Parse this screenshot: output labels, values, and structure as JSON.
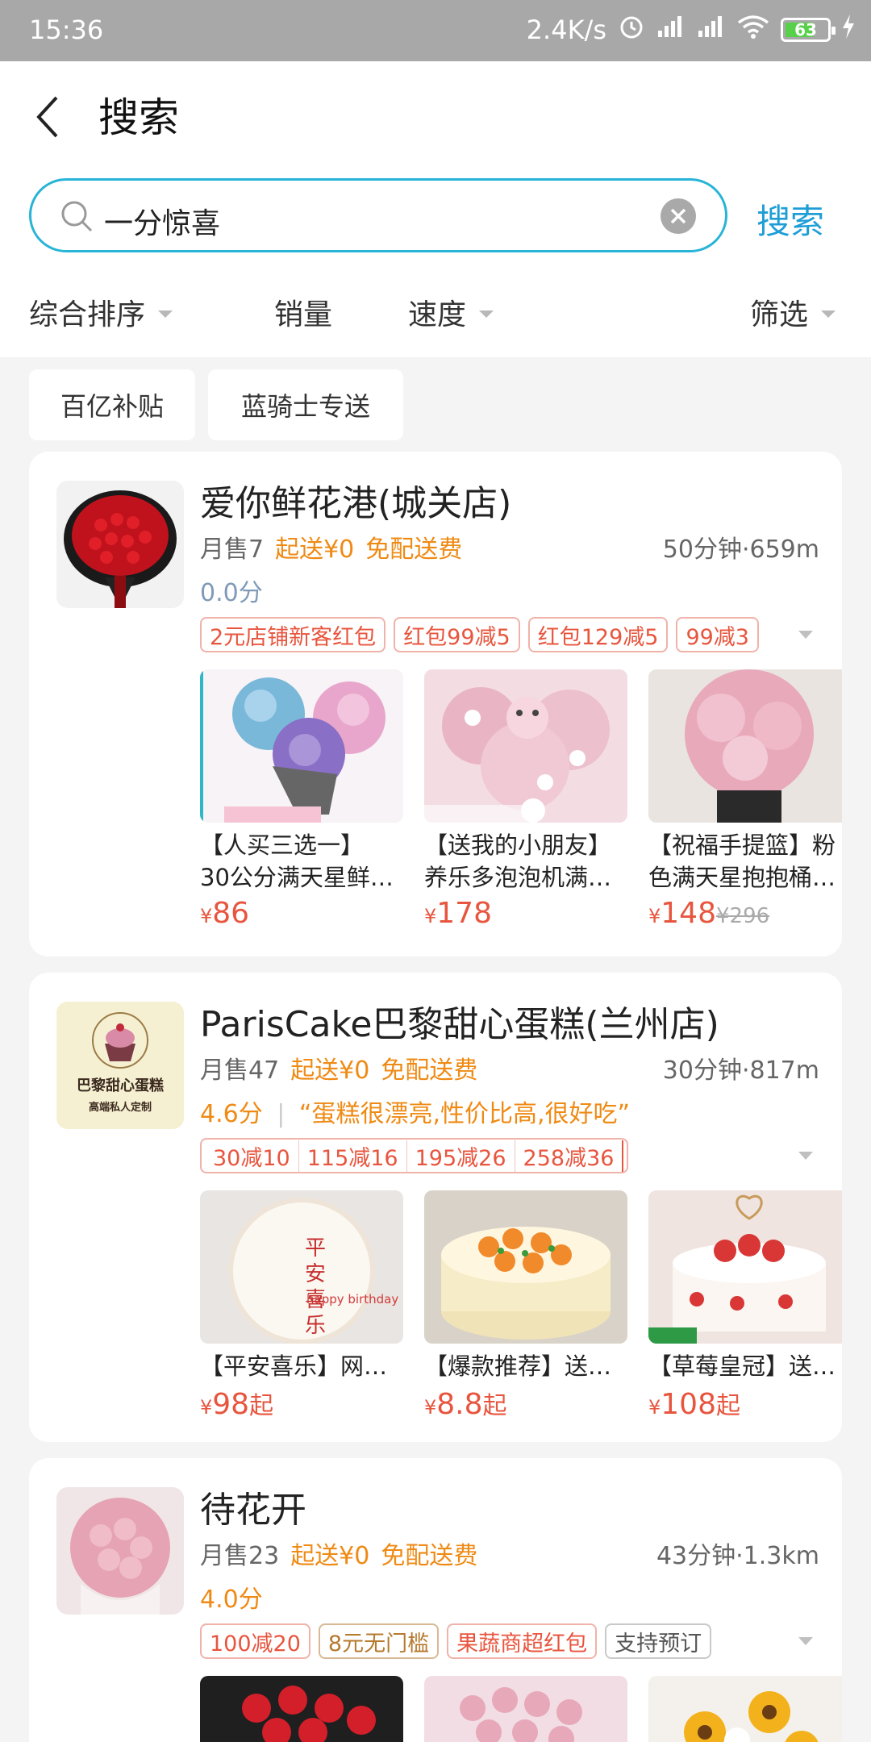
{
  "status": {
    "time": "15:36",
    "speed": "2.4K/s",
    "battery": "63"
  },
  "header": {
    "title": "搜索"
  },
  "search": {
    "query": "一分惊喜",
    "button": "搜索"
  },
  "sort": {
    "comprehensive": "综合排序",
    "sales": "销量",
    "speed": "速度",
    "filter": "筛选"
  },
  "chips": [
    "百亿补贴",
    "蓝骑士专送"
  ],
  "shops": [
    {
      "name": "爱你鲜花港(城关店)",
      "monthly": "月售7",
      "min_order": "起送¥0",
      "delivery": "免配送费",
      "distance": "50分钟·659m",
      "rating": "0.0分",
      "tags": [
        "2元店铺新客红包",
        "红包99减5",
        "红包129减5",
        "99减3"
      ],
      "products": [
        {
          "title1": "【人买三选一】",
          "title2": "30公分满天星鲜…",
          "price": "86",
          "old_price": ""
        },
        {
          "title1": "【送我的小朋友】",
          "title2": "养乐多泡泡机满…",
          "price": "178",
          "old_price": ""
        },
        {
          "title1": "【祝福手提篮】粉",
          "title2": "色满天星抱抱桶…",
          "price": "148",
          "old_price": "¥296"
        }
      ]
    },
    {
      "name": "ParisCake巴黎甜心蛋糕(兰州店)",
      "monthly": "月售47",
      "min_order": "起送¥0",
      "delivery": "免配送费",
      "distance": "30分钟·817m",
      "rating": "4.6分",
      "review": "“蛋糕很漂亮,性价比高,很好吃”",
      "logo_text": "巴黎甜心蛋糕",
      "logo_sub": "高端私人定制",
      "tags": [
        "30减10",
        "115减16",
        "195减26",
        "258减36"
      ],
      "products": [
        {
          "title1": "【平安喜乐】网…",
          "price": "98",
          "suffix": "起",
          "cake_text": "平安喜乐"
        },
        {
          "title1": "【爆款推荐】送…",
          "price": "8.8",
          "suffix": "起"
        },
        {
          "title1": "【草莓皇冠】送…",
          "price": "108",
          "suffix": "起"
        }
      ]
    },
    {
      "name": "待花开",
      "monthly": "月售23",
      "min_order": "起送¥0",
      "delivery": "免配送费",
      "distance": "43分钟·1.3km",
      "rating": "4.0分",
      "tags": [
        "100减20",
        "8元无门槛",
        "果蔬商超红包",
        "支持预订"
      ]
    }
  ],
  "colors": {
    "accent": "#1f9ed6",
    "price": "#e8553e",
    "orange": "#ef8a14"
  }
}
